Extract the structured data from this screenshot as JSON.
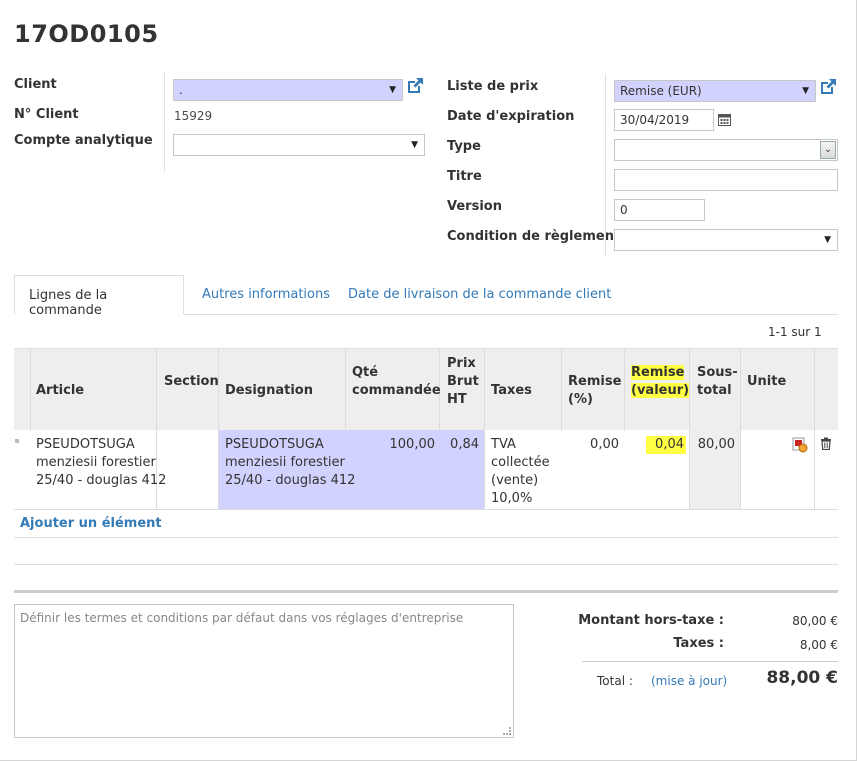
{
  "record": {
    "title": "17OD0105"
  },
  "left_form": {
    "client_label": "Client",
    "client_value": ".",
    "client_num_label": "N° Client",
    "client_num_value": "15929",
    "analytic_label": "Compte analytique",
    "analytic_value": ""
  },
  "right_form": {
    "pricelist_label": "Liste de prix",
    "pricelist_value": "Remise (EUR)",
    "expiry_label": "Date d'expiration",
    "expiry_value": "30/04/2019",
    "type_label": "Type",
    "type_value": "",
    "titre_label": "Titre",
    "titre_value": "",
    "version_label": "Version",
    "version_value": "0",
    "payment_label": "Condition de règlement",
    "payment_value": ""
  },
  "tabs": [
    {
      "label": "Lignes de la commande"
    },
    {
      "label": "Autres informations"
    },
    {
      "label": "Date de livraison de la commande client"
    }
  ],
  "pager": {
    "text": "1-1 sur 1"
  },
  "table": {
    "headers": {
      "article": "Article",
      "section": "Section",
      "designation": "Designation",
      "qty_1": "Qté",
      "qty_2": "commandée",
      "prix_1": "Prix",
      "prix_2": "Brut",
      "prix_3": "HT",
      "taxes": "Taxes",
      "remise_1": "Remise",
      "remise_2": "(%)",
      "remval_1": "Remise",
      "remval_2": "(valeur)",
      "sous_1": "Sous-",
      "sous_2": "total",
      "unite": "Unite"
    },
    "row": {
      "article_1": "PSEUDOTSUGA",
      "article_2": "menziesii forestier",
      "article_3": "25/40 - douglas 412",
      "section": "",
      "designation_1": "PSEUDOTSUGA",
      "designation_2": "menziesii forestier",
      "designation_3": "25/40 - douglas 412",
      "qty": "100,00",
      "prix": "0,84",
      "taxes_1": "TVA",
      "taxes_2": "collectée",
      "taxes_3": "(vente)",
      "taxes_4": "10,0%",
      "remise_pct": "0,00",
      "remise_val": "0,04",
      "sous_total": "80,00",
      "unite": ""
    },
    "add_label": "Ajouter un élément"
  },
  "notes": {
    "placeholder": "Définir les termes et conditions par défaut dans vos réglages d'entreprise"
  },
  "totals": {
    "untaxed_label": "Montant hors-taxe :",
    "untaxed_value": "80,00 €",
    "taxes_label": "Taxes :",
    "taxes_value": "8,00 €",
    "total_label": "Total :",
    "update_label": "(mise à jour)",
    "total_value": "88,00 €"
  },
  "colors": {
    "required_field": "#d2d2ff",
    "link": "#337ab7",
    "highlight": "#ffff44",
    "header_bg": "#eeeeee"
  },
  "icons": [
    "external-link-icon",
    "calendar-icon",
    "dropdown-caret-icon",
    "drag-handle-icon",
    "image-status-icon",
    "trash-icon"
  ]
}
